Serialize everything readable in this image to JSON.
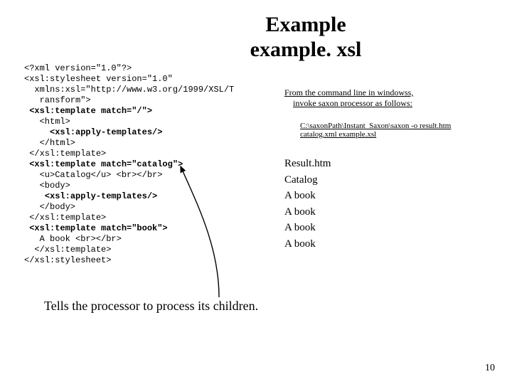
{
  "title_line1": "Example",
  "title_line2": "example. xsl",
  "code": "<?xml version=\"1.0\"?>\n<xsl:stylesheet version=\"1.0\"\n  xmlns:xsl=\"http://www.w3.org/1999/XSL/T\n   ransform\">\n <b><xsl:template match=\"/\"></b>\n   <html>\n     <b><xsl:apply-templates/></b>\n   </html>\n </xsl:template>\n <b><xsl:template match=\"catalog\"></b>\n   <u>Catalog</u> <br></br>\n   <body>\n    <b><xsl:apply-templates/></b>\n   </body>\n </xsl:template>\n <b><xsl:template match=\"book\"></b>\n   A book <br></br>\n  </xsl:template>\n</xsl:stylesheet>",
  "cmd_line1": "From the command line in windowss,",
  "cmd_line2": "invoke saxon  processor as follows:",
  "path": "C:\\saxonPath\\Instant_Saxon\\saxon -o result.htm catalog.xml example.xsl",
  "result_lines": [
    "Result.htm",
    "Catalog",
    "A book",
    "A book",
    "A book",
    "A book"
  ],
  "caption": "Tells the processor to process its children.",
  "page_number": "10"
}
